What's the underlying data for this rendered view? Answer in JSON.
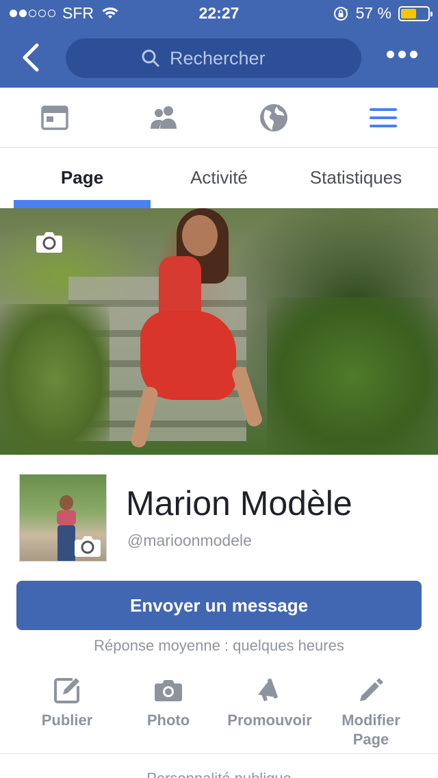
{
  "status_bar": {
    "carrier": "SFR",
    "time": "22:27",
    "battery_percent": "57 %",
    "battery_level": 0.57,
    "signal_bars_filled": 2,
    "signal_bars_total": 5,
    "battery_color": "#f7c600"
  },
  "nav": {
    "back_icon": "chevron-left-icon",
    "search_placeholder": "Rechercher",
    "more_icon": "more-dots-icon",
    "bar_color": "#4267b2"
  },
  "icon_tabs": [
    {
      "icon": "news-feed-icon",
      "active": false
    },
    {
      "icon": "friends-icon",
      "active": false
    },
    {
      "icon": "globe-icon",
      "active": false
    },
    {
      "icon": "menu-icon",
      "active": true
    }
  ],
  "tabs": [
    {
      "label": "Page",
      "active": true
    },
    {
      "label": "Activité",
      "active": false
    },
    {
      "label": "Statistiques",
      "active": false
    }
  ],
  "profile": {
    "name": "Marion Modèle",
    "handle": "@marioonmodele"
  },
  "message_button": "Envoyer un message",
  "response_time": "Réponse moyenne : quelques heures",
  "actions": [
    {
      "icon": "edit-icon",
      "label": "Publier"
    },
    {
      "icon": "camera-icon",
      "label": "Photo"
    },
    {
      "icon": "megaphone-icon",
      "label": "Promouvoir"
    },
    {
      "icon": "pencil-icon",
      "label": "Modifier\nPage"
    }
  ],
  "bottom_text": "Personnalité publique",
  "colors": {
    "accent": "#4267b2",
    "tab_indicator": "#4a80f0",
    "icon_gray": "#8d949e",
    "active_icon": "#4a80f0"
  }
}
